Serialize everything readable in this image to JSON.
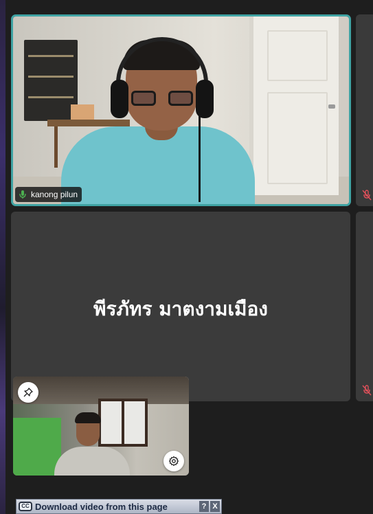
{
  "participants": {
    "active_speaker": {
      "name": "kanong pilun",
      "mic_icon": "mic-on-icon"
    },
    "no_video": {
      "display_name": "พีรภัทร มาตงามเมือง"
    },
    "side_tiles": [
      {
        "mic_icon": "mic-muted-icon"
      },
      {
        "mic_icon": "mic-muted-icon"
      }
    ],
    "self_view": {
      "pin_icon": "pin-icon",
      "settings_icon": "gear-icon"
    }
  },
  "extension_bar": {
    "cc_label": "CC",
    "text": "Download video from this page",
    "help_label": "?",
    "close_label": "X"
  },
  "colors": {
    "background": "#1e1e1e",
    "tile": "#3b3b3b",
    "active_border": "#3fa3a3",
    "muted_red": "#e0505a",
    "mic_green": "#4caf50"
  }
}
